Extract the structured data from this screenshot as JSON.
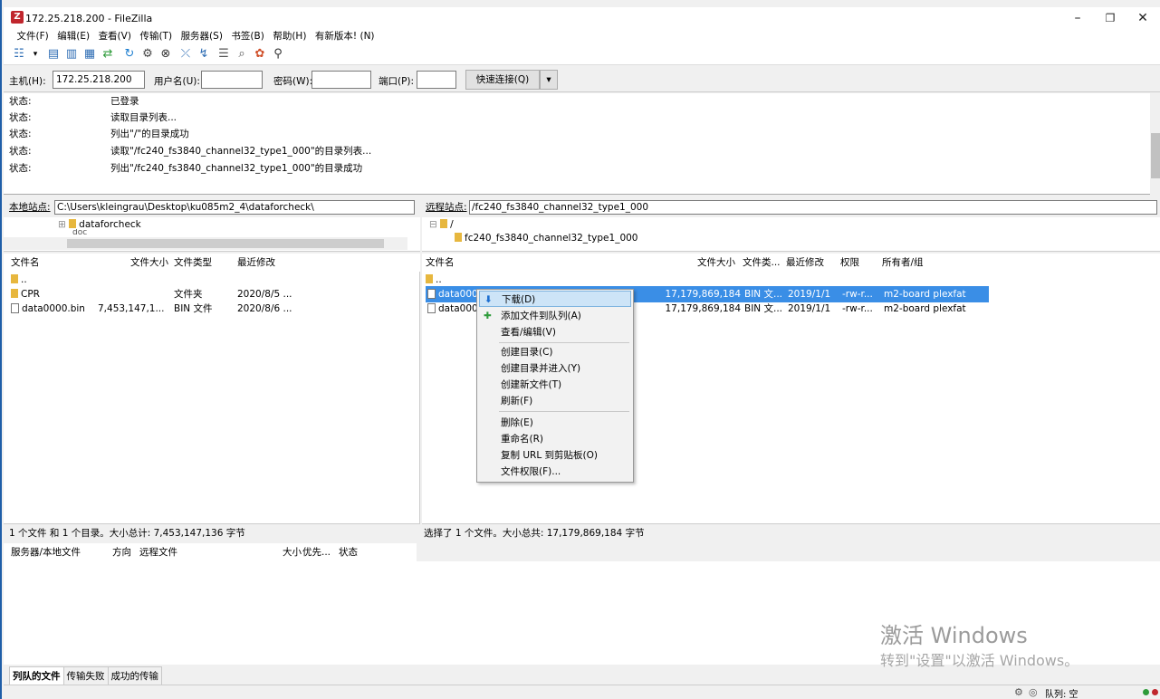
{
  "window": {
    "title": "172.25.218.200 - FileZilla",
    "logo": "Z"
  },
  "menu": [
    "文件(F)",
    "编辑(E)",
    "查看(V)",
    "传输(T)",
    "服务器(S)",
    "书签(B)",
    "帮助(H)",
    "有新版本! (N)"
  ],
  "toolbar_icons": [
    "site-manager-icon",
    "dropdown-arrow-icon",
    "toggle-log-icon",
    "toggle-local-tree-icon",
    "toggle-remote-tree-icon",
    "toggle-queue-icon",
    "refresh-icon",
    "process-queue-icon",
    "cancel-icon",
    "disconnect-icon",
    "reconnect-icon",
    "filter-icon",
    "compare-icon",
    "sync-browse-icon",
    "search-icon"
  ],
  "quickconnect": {
    "host_label": "主机(H):",
    "host_value": "172.25.218.200",
    "user_label": "用户名(U):",
    "user_value": "",
    "pass_label": "密码(W):",
    "pass_value": "",
    "port_label": "端口(P):",
    "port_value": "",
    "connect_label": "快速连接(Q)",
    "dropdown": "▾"
  },
  "log": [
    {
      "k": "状态:",
      "v": "已登录"
    },
    {
      "k": "状态:",
      "v": "读取目录列表..."
    },
    {
      "k": "状态:",
      "v": "列出\"/\"的目录成功"
    },
    {
      "k": "状态:",
      "v": "读取\"/fc240_fs3840_channel32_type1_000\"的目录列表..."
    },
    {
      "k": "状态:",
      "v": "列出\"/fc240_fs3840_channel32_type1_000\"的目录成功"
    }
  ],
  "local": {
    "site_label": "本地站点:",
    "site_path": "C:\\Users\\kleingrau\\Desktop\\ku085m2_4\\dataforcheck\\",
    "tree": [
      "dataforcheck",
      "doc"
    ],
    "columns": [
      "文件名",
      "文件大小",
      "文件类型",
      "最近修改"
    ],
    "rows": [
      {
        "name": "..",
        "size": "",
        "type": "",
        "modified": ""
      },
      {
        "name": "CPR",
        "size": "",
        "type": "文件夹",
        "modified": "2020/8/5 ..."
      },
      {
        "name": "data0000.bin",
        "size": "7,453,147,1...",
        "type": "BIN 文件",
        "modified": "2020/8/6 ..."
      }
    ],
    "status": "1 个文件 和 1 个目录。大小总计: 7,453,147,136 字节"
  },
  "remote": {
    "site_label": "远程站点:",
    "site_path": "/fc240_fs3840_channel32_type1_000",
    "tree": [
      "/",
      "fc240_fs3840_channel32_type1_000"
    ],
    "columns": [
      "文件名",
      "文件大小",
      "文件类...",
      "最近修改",
      "权限",
      "所有者/组"
    ],
    "rows": [
      {
        "name": "..",
        "size": "",
        "type": "",
        "modified": "",
        "perm": "",
        "owner": ""
      },
      {
        "name": "data0000",
        "size": "17,179,869,184",
        "type": "BIN 文...",
        "modified": "2019/1/1",
        "perm": "-rw-r...",
        "owner": "m2-board plexfat"
      },
      {
        "name": "data0000",
        "size": "17,179,869,184",
        "type": "BIN 文...",
        "modified": "2019/1/1",
        "perm": "-rw-r...",
        "owner": "m2-board plexfat"
      }
    ],
    "status": "选择了 1 个文件。大小总共: 17,179,869,184 字节"
  },
  "context_menu": [
    {
      "label": "下载(D)",
      "icon": "download-icon"
    },
    {
      "label": "添加文件到队列(A)",
      "icon": "add-queue-icon"
    },
    {
      "label": "查看/编辑(V)"
    },
    {
      "label": "创建目录(C)"
    },
    {
      "label": "创建目录并进入(Y)"
    },
    {
      "label": "创建新文件(T)"
    },
    {
      "label": "刷新(F)"
    },
    {
      "label": "删除(E)"
    },
    {
      "label": "重命名(R)"
    },
    {
      "label": "复制 URL 到剪贴板(O)"
    },
    {
      "label": "文件权限(F)..."
    }
  ],
  "queue": {
    "columns": [
      "服务器/本地文件",
      "方向",
      "远程文件",
      "大小",
      "优先...",
      "状态"
    ],
    "tabs": [
      "列队的文件",
      "传输失败",
      "成功的传输"
    ],
    "status": "队列: 空"
  },
  "activation": {
    "line1": "激活 Windows",
    "line2": "转到\"设置\"以激活 Windows。"
  },
  "colors": {
    "selection": "#3a8ee6",
    "folder": "#e7b73e",
    "border": "#1f5ea8"
  }
}
